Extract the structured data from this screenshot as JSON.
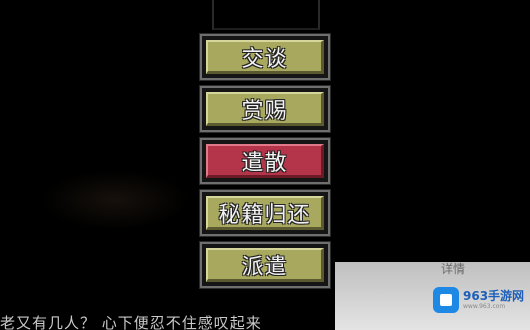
{
  "menu": {
    "items": [
      {
        "label": "交谈",
        "color": "#a8a85f"
      },
      {
        "label": "赏赐",
        "color": "#a8a85f"
      },
      {
        "label": "遣散",
        "color": "#b4344a"
      },
      {
        "label": "秘籍归还",
        "color": "#a8a85f"
      },
      {
        "label": "派遣",
        "color": "#a8a85f"
      }
    ]
  },
  "dialogue": {
    "text": "老又有几人？ 心下便忍不住感叹起来"
  },
  "panel": {
    "label": "详情"
  },
  "watermark": {
    "name": "963手游网",
    "url": "www.963.com"
  }
}
